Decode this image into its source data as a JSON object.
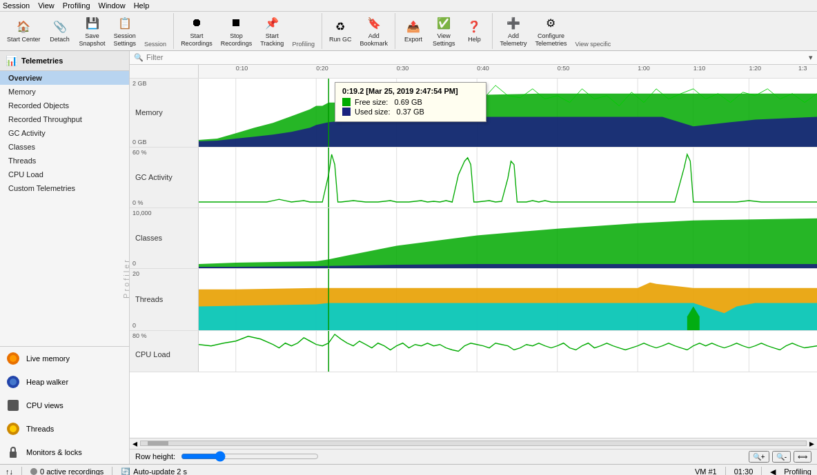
{
  "menu": {
    "items": [
      "Session",
      "View",
      "Profiling",
      "Window",
      "Help"
    ]
  },
  "toolbar": {
    "groups": [
      {
        "label": "Session",
        "buttons": [
          {
            "id": "start-center",
            "label": "Start\nCenter",
            "icon": "🏠"
          },
          {
            "id": "detach",
            "label": "Detach",
            "icon": "📎"
          },
          {
            "id": "save-snapshot",
            "label": "Save\nSnapshot",
            "icon": "💾"
          },
          {
            "id": "session-settings",
            "label": "Session\nSettings",
            "icon": "📋"
          }
        ]
      },
      {
        "label": "Profiling",
        "buttons": [
          {
            "id": "start-recordings",
            "label": "Start\nRecordings",
            "icon": "⏺"
          },
          {
            "id": "stop-recordings",
            "label": "Stop\nRecordings",
            "icon": "⏹"
          },
          {
            "id": "start-tracking",
            "label": "Start\nTracking",
            "icon": "📌"
          }
        ]
      },
      {
        "label": "",
        "buttons": [
          {
            "id": "run-gc",
            "label": "Run GC",
            "icon": "♻"
          },
          {
            "id": "add-bookmark",
            "label": "Add\nBookmark",
            "icon": "🔖"
          }
        ]
      },
      {
        "label": "",
        "buttons": [
          {
            "id": "export",
            "label": "Export",
            "icon": "📤"
          },
          {
            "id": "view-settings",
            "label": "View\nSettings",
            "icon": "✅"
          },
          {
            "id": "help",
            "label": "Help",
            "icon": "❓"
          }
        ]
      },
      {
        "label": "View specific",
        "buttons": [
          {
            "id": "add-telemetry",
            "label": "Add\nTelemetry",
            "icon": "➕"
          },
          {
            "id": "configure-telemetries",
            "label": "Configure\nTelemetries",
            "icon": "⚙"
          }
        ]
      }
    ]
  },
  "sidebar": {
    "telemetry_label": "Telemetries",
    "nav_items": [
      {
        "id": "overview",
        "label": "Overview",
        "active": true
      },
      {
        "id": "memory",
        "label": "Memory"
      },
      {
        "id": "recorded-objects",
        "label": "Recorded Objects"
      },
      {
        "id": "recorded-throughput",
        "label": "Recorded Throughput"
      },
      {
        "id": "gc-activity",
        "label": "GC Activity"
      },
      {
        "id": "classes",
        "label": "Classes"
      },
      {
        "id": "threads",
        "label": "Threads"
      },
      {
        "id": "cpu-load",
        "label": "CPU Load"
      },
      {
        "id": "custom-telemetries",
        "label": "Custom Telemetries"
      }
    ],
    "tools": [
      {
        "id": "live-memory",
        "label": "Live memory",
        "icon": "🟠"
      },
      {
        "id": "heap-walker",
        "label": "Heap walker",
        "icon": "🔵"
      },
      {
        "id": "cpu-views",
        "label": "CPU views",
        "icon": "⬜"
      },
      {
        "id": "threads-tool",
        "label": "Threads",
        "icon": "🟡"
      },
      {
        "id": "monitors-locks",
        "label": "Monitors & locks",
        "icon": "🔒"
      }
    ]
  },
  "filter": {
    "placeholder": "Filter"
  },
  "charts": {
    "time_ticks": [
      "0:10",
      "0:20",
      "0:30",
      "0:40",
      "0:50",
      "1:00",
      "1:10",
      "1:20",
      "1:3"
    ],
    "cursor_position_pct": 21,
    "tooltip": {
      "title": "0:19.2 [Mar 25, 2019 2:47:54 PM]",
      "rows": [
        {
          "color": "#00aa00",
          "label": "Free size:",
          "value": "0.69 GB"
        },
        {
          "color": "#1a237e",
          "label": "Used size:",
          "value": "0.37 GB"
        }
      ]
    },
    "rows": [
      {
        "id": "memory",
        "label": "Memory",
        "y_top": "2 GB",
        "y_bottom": "0 GB",
        "height": 100
      },
      {
        "id": "gc-activity",
        "label": "GC Activity",
        "y_top": "60 %",
        "y_bottom": "0 %",
        "height": 90
      },
      {
        "id": "classes",
        "label": "Classes",
        "y_top": "10,000",
        "y_bottom": "0",
        "height": 90
      },
      {
        "id": "threads",
        "label": "Threads",
        "y_top": "20",
        "y_bottom": "0",
        "height": 90
      },
      {
        "id": "cpu-load",
        "label": "CPU Load",
        "y_top": "80 %",
        "y_bottom": "",
        "height": 60
      }
    ]
  },
  "row_height": {
    "label": "Row height:"
  },
  "status_bar": {
    "arrows": "↑↓",
    "recordings": "0 active recordings",
    "auto_update": "Auto-update 2 s",
    "vm": "VM #1",
    "time": "01:30",
    "profiling": "Profiling"
  }
}
